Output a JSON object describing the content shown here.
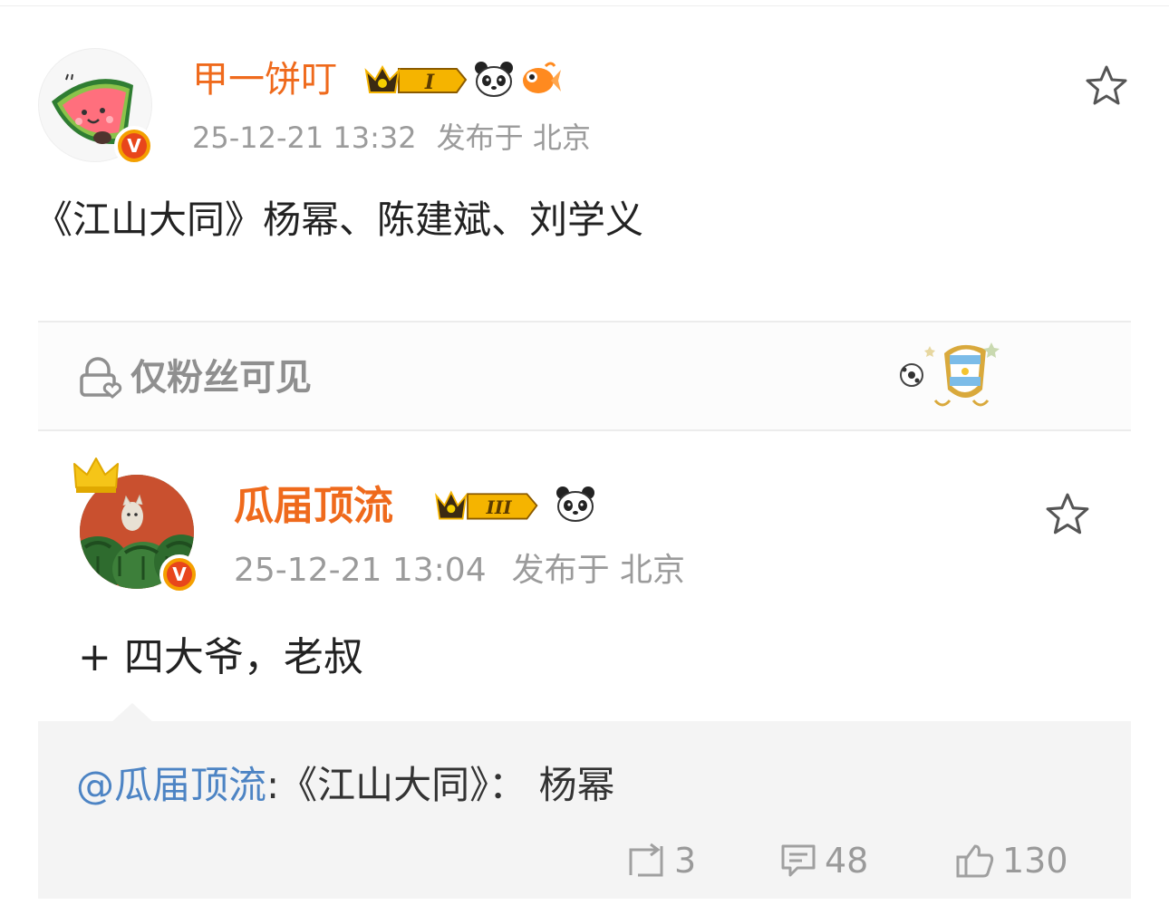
{
  "post": {
    "author": "甲一饼叮",
    "level_badge": "I",
    "timestamp": "25-12-21 13:32",
    "location": "发布于 北京",
    "text": "《江山大同》杨幂、陈建斌、刘学义",
    "verified_mark": "V"
  },
  "fans_only": {
    "label": "仅粉丝可见"
  },
  "repost": {
    "author": "瓜届顶流",
    "level_badge": "III",
    "timestamp": "25-12-21 13:04",
    "location": "发布于 北京",
    "text": "+ 四大爷，老叔",
    "verified_mark": "V"
  },
  "quoted": {
    "mention": "@瓜届顶流",
    "text": ":《江山大同》：  杨幂"
  },
  "actions": {
    "repost_count": "3",
    "comment_count": "48",
    "like_count": "130"
  },
  "icons": {
    "favorite": "star-outline-icon",
    "lock": "lock-heart-icon",
    "repost": "repost-icon",
    "comment": "comment-icon",
    "like": "thumbs-up-icon"
  },
  "colors": {
    "username": "#ef6a1c",
    "mention": "#4d84c4",
    "meta": "#9b9b9b",
    "verified": "#e8461b"
  }
}
